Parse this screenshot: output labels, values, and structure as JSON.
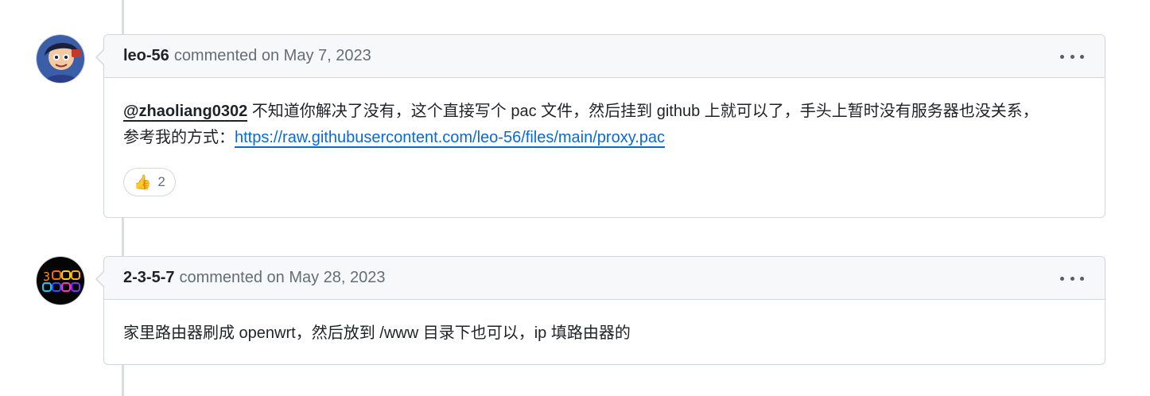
{
  "comments": [
    {
      "author": "leo-56",
      "meta": "commented on May 7, 2023",
      "mention": "@zhaoliang0302",
      "line1_text": " 不知道你解决了没有，这个直接写个 pac 文件，然后挂到 github 上就可以了，手头上暂时没有服务器也没关系，",
      "line2_text": "参考我的方式：",
      "link": "https://raw.githubusercontent.com/leo-56/files/main/proxy.pac",
      "reaction": {
        "emoji": "👍",
        "icon": "thumbs-up-icon",
        "count": "2"
      }
    },
    {
      "author": "2-3-5-7",
      "meta": "commented on May 28, 2023",
      "body": "家里路由器刷成 openwrt，然后放到 /www 目录下也可以，ip 填路由器的"
    }
  ],
  "colors": {
    "border": "#d0d7de",
    "header_bg": "#f6f8fa",
    "link": "#0969da",
    "muted": "#656d76",
    "timeline": "#d8dee4"
  }
}
